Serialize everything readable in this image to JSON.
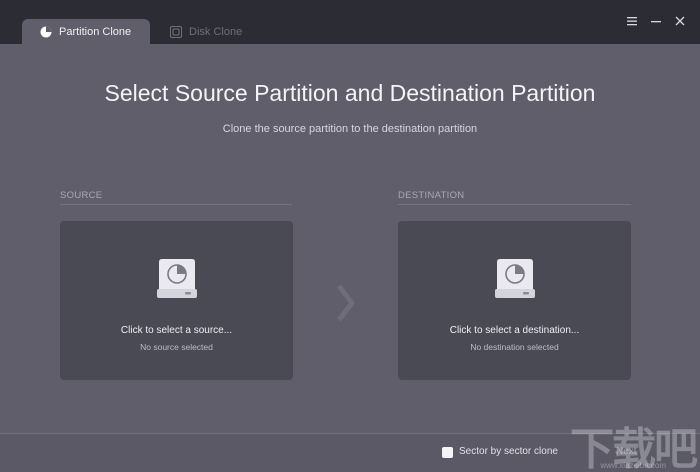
{
  "tabs": [
    {
      "label": "Partition Clone",
      "icon": "pie-chart-icon",
      "active": true
    },
    {
      "label": "Disk Clone",
      "icon": "disk-clone-icon",
      "active": false
    }
  ],
  "window_controls": [
    "menu-icon",
    "minimize-icon",
    "close-icon"
  ],
  "main": {
    "title": "Select Source Partition and Destination Partition",
    "subtitle": "Clone the source partition to the destination partition"
  },
  "source": {
    "section_label": "SOURCE",
    "prompt": "Click to select a source...",
    "status": "No source selected"
  },
  "destination": {
    "section_label": "DESTINATION",
    "prompt": "Click to select a destination...",
    "status": "No destination selected"
  },
  "footer": {
    "sector_clone_label": "Sector by sector clone",
    "sector_clone_checked": false,
    "next_label": "Next"
  },
  "watermark": {
    "text": "下载吧",
    "url": "www.xiazaiba.com"
  },
  "colors": {
    "titlebar": "#2c2c35",
    "body": "#5f5e6a",
    "card": "#4a4a55",
    "disk_body": "#e9e9ef"
  }
}
